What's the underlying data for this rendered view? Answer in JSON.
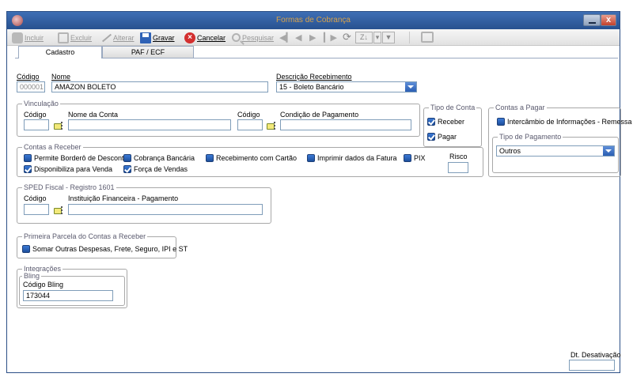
{
  "window": {
    "title": "Formas de Cobrança",
    "close_glyph": "x"
  },
  "toolbar": {
    "incluir": "Incluir",
    "excluir": "Excluir",
    "alterar": "Alterar",
    "gravar": "Gravar",
    "cancelar": "Cancelar",
    "pesquisar": "Pesquisar",
    "sort_glyph": "Z↓",
    "funnel_glyph": "▼"
  },
  "tabs": [
    {
      "label": "Cadastro"
    },
    {
      "label": "PAF / ECF"
    }
  ],
  "main": {
    "codigo_label": "Código",
    "codigo_value": "000001",
    "nome_label": "Nome",
    "nome_value": "AMAZON BOLETO",
    "descricao_label": "Descrição Recebimento",
    "descricao_value": "15 - Boleto Bancário"
  },
  "vinculacao": {
    "title": "Vinculação",
    "codigo_label": "Código",
    "nome_conta_label": "Nome da Conta",
    "codigo2_label": "Código",
    "condicao_label": "Condição de Pagamento"
  },
  "tipo_conta": {
    "title": "Tipo de Conta",
    "receber": "Receber",
    "pagar": "Pagar"
  },
  "contas_pagar": {
    "title": "Contas a Pagar",
    "intercambio": "Intercâmbio de Informações - Remessa",
    "tipo_pagamento_title": "Tipo de Pagamento",
    "tipo_pagamento_value": "Outros"
  },
  "contas_receber": {
    "title": "Contas a Receber",
    "permite_bordero": "Permite Borderô de Desconto",
    "cobranca_bancaria": "Cobrança Bancária",
    "recebimento_cartao": "Recebimento com Cartão",
    "imprimir_fatura": "Imprimir dados da Fatura",
    "pix": "PIX",
    "risco_label": "Risco",
    "disponibiliza_venda": "Disponibiliza para Venda",
    "forca_vendas": "Força de Vendas"
  },
  "sped": {
    "title": "SPED Fiscal - Registro 1601",
    "codigo_label": "Código",
    "instituicao_label": "Instituição Financeira - Pagamento"
  },
  "primeira_parcela": {
    "title": "Primeira Parcela do Contas a Receber",
    "somar": "Somar Outras Despesas, Frete, Seguro, IPI e ST"
  },
  "integracoes": {
    "title": "Integrações",
    "bling_title": "Bling",
    "codigo_bling_label": "Código Bling",
    "codigo_bling_value": "173044"
  },
  "dt_desativacao_label": "Dt. Desativação"
}
